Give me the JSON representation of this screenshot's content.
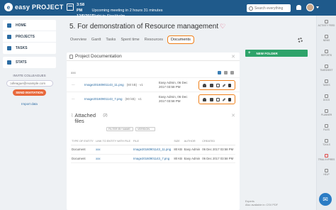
{
  "app": {
    "logo_letter": "e",
    "logo_text": "easy PROJECT"
  },
  "topbar": {
    "meetings": [
      {
        "time": "3:58 PM",
        "title": "Upcoming meeting in 2 hours 31 minutes"
      },
      {
        "time": "12/6/2017",
        "title": "Flight to Stockholm"
      }
    ],
    "search_placeholder": "Search everything"
  },
  "sidebar": {
    "items": [
      {
        "label": "HOME",
        "icon": "home-icon"
      },
      {
        "label": "PROJECTS",
        "icon": "projects-icon"
      },
      {
        "label": "TASKS",
        "icon": "tasks-icon"
      },
      {
        "label": "STATS",
        "icon": "stats-icon"
      }
    ],
    "invite_title": "INVITE COLLEAGUES",
    "invite_placeholder": "colleague@example.com",
    "invite_button": "SEND INVITATION",
    "import_link": "Import data"
  },
  "main": {
    "title": "5. For demonstration of Resource management",
    "tabs": [
      "Overview",
      "Gantt",
      "Tasks",
      "Spent time",
      "Resources",
      "Documents"
    ],
    "active_tab": "Documents",
    "panel_title": "Project Documentation",
    "subhead": "xxx",
    "documents": [
      {
        "name": "Image20160901143_11.png",
        "size": "(80 kB) · v1",
        "author": "Easy Admin, 06 Dec",
        "date": "2017 03:58 PM"
      },
      {
        "name": "Image20160901143_7.png",
        "size": "(80 kB) · v1",
        "author": "Easy Admin, 06 Dec",
        "date": "2017 03:58 PM"
      }
    ],
    "attached": {
      "title": "Attached files",
      "count": "(2)",
      "filter1": "FILTER BY NAME",
      "filter2": "VERSION",
      "headers": [
        "TYPE OF ENTITY",
        "LINK TO ENTITY WITH FILE",
        "FILE",
        "SIZE",
        "AUTHOR",
        "CREATED"
      ],
      "rows": [
        {
          "type": "Document",
          "link": "xxx",
          "file": "Image20160901143_11.png",
          "size": "80 KB",
          "author": "Easy Admin",
          "created": "06 Dec 2017 03:58 PM"
        },
        {
          "type": "Document",
          "link": "xxx",
          "file": "Image20160901143_7.png",
          "size": "80 KB",
          "author": "Easy Admin",
          "created": "06 Dec 2017 03:58 PM"
        }
      ]
    }
  },
  "right": {
    "new_folder": "NEW FOLDER",
    "experts": "Experts",
    "export_line": "Also available in: CSV PDF"
  },
  "rail": [
    {
      "label": "ACTIVITY FEED",
      "icon": "activity-icon"
    },
    {
      "label": "NEWS",
      "icon": "news-icon"
    },
    {
      "label": "REPORTS",
      "icon": "reports-icon"
    },
    {
      "label": "TIMESHEET",
      "icon": "timesheet-icon"
    },
    {
      "label": "TASKS",
      "icon": "tasks-rail-icon"
    },
    {
      "label": "DOCS",
      "icon": "docs-icon"
    },
    {
      "label": "PLANNER",
      "icon": "planner-icon"
    },
    {
      "label": "FILES",
      "icon": "files-icon"
    },
    {
      "label": "TOOLS",
      "icon": "tools-icon"
    },
    {
      "label": "TRIAL EXPIRES",
      "icon": "trial-icon"
    },
    {
      "label": "HELP",
      "icon": "help-icon"
    }
  ],
  "colors": {
    "brand": "#1f5a8b",
    "accent": "#f07f18",
    "success": "#2ea36a",
    "heart": "#e04a6f"
  }
}
